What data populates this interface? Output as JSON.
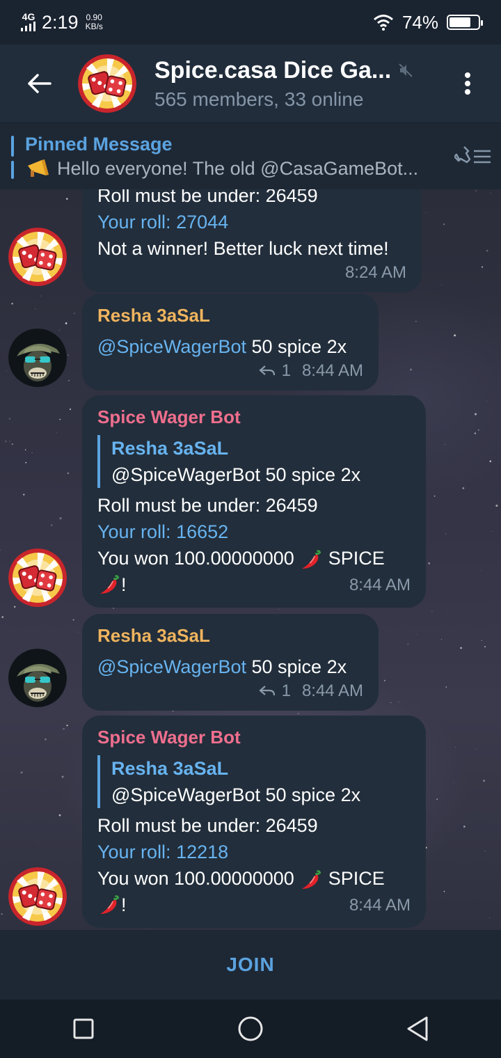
{
  "status_bar": {
    "network": "4G",
    "time": "2:19",
    "speed_value": "0.90",
    "speed_unit": "KB/s",
    "battery": "74%",
    "battery_level": 0.74
  },
  "header": {
    "title": "Spice.casa Dice Ga...",
    "subtitle": "565 members, 33 online"
  },
  "pinned": {
    "title": "Pinned Message",
    "text": "Hello everyone! The old @CasaGameBot..."
  },
  "messages": [
    {
      "partial_line": "Roll must be under: 26459",
      "roll": "Your roll: 27044",
      "result": "Not a winner! Better luck next time!",
      "time": "8:24 AM"
    },
    {
      "sender": "Resha 3aSaL",
      "mention": "@SpiceWagerBot",
      "text": " 50 spice 2x",
      "replies": "1",
      "time": "8:44 AM"
    },
    {
      "sender": "Spice Wager Bot",
      "quote_name": "Resha 3aSaL",
      "quote_text": "@SpiceWagerBot 50 spice 2x",
      "rule": "Roll must be under: 26459",
      "roll": "Your roll: 16652",
      "won_prefix": "You won 100.00000000 ",
      "won_token": " SPICE",
      "won_end": "!",
      "time": "8:44 AM"
    },
    {
      "sender": "Resha 3aSaL",
      "mention": "@SpiceWagerBot",
      "text": " 50 spice 2x",
      "replies": "1",
      "time": "8:44 AM"
    },
    {
      "sender": "Spice Wager Bot",
      "quote_name": "Resha 3aSaL",
      "quote_text": "@SpiceWagerBot 50 spice 2x",
      "rule": "Roll must be under: 26459",
      "roll": "Your roll: 12218",
      "won_prefix": "You won 100.00000000 ",
      "won_token": " SPICE",
      "won_end": "!",
      "time": "8:44 AM"
    }
  ],
  "join_bar": {
    "label": "JOIN"
  },
  "colors": {
    "accent": "#5ba3e0",
    "user_name": "#f0b45e",
    "bot_name": "#ef6f8e",
    "bubble": "#222e3b"
  }
}
